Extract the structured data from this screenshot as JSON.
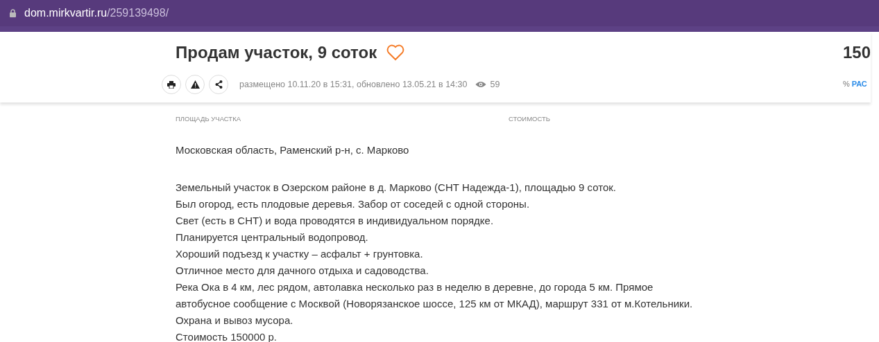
{
  "address_bar": {
    "domain": "dom.mirkvartir.ru",
    "path": "/259139498/"
  },
  "header": {
    "title": "Продам участок, 9 соток",
    "favorite": false,
    "price": "150",
    "meta": "размещено 10.11.20 в 15:31, обновлено 13.05.21 в 14:30",
    "views": "59",
    "percent": "%",
    "calc_link": "РАС"
  },
  "stats": [
    {
      "label": "ПЛОЩАДЬ УЧАСТКА"
    },
    {
      "label": "СТОИМОСТЬ"
    }
  ],
  "address": "Московская область, Раменский р-н, с. Марково",
  "description": [
    "Земельный участок в Озерском районе в д. Марково (СНТ Надежда-1), площадью 9 соток.",
    "Был огород, есть плодовые деревья. Забор от соседей с одной стороны.",
    "Свет (есть в СНТ) и вода проводятся в индивидуальном порядке.",
    "Планируется центральный водопровод.",
    "Хороший подъезд к участку – асфальт + грунтовка.",
    "Отличное место для дачного отдыха и садоводства.",
    "Река Ока в 4 км, лес рядом, автолавка несколько раз в неделю в деревне, до города 5 км. Прямое",
    "автобусное сообщение с Москвой (Новорязанское шоссе, 125 км от МКАД), маршрут 331 от м.Котельники.",
    "Охрана и вывоз мусора.",
    "Стоимость 150000 р."
  ]
}
